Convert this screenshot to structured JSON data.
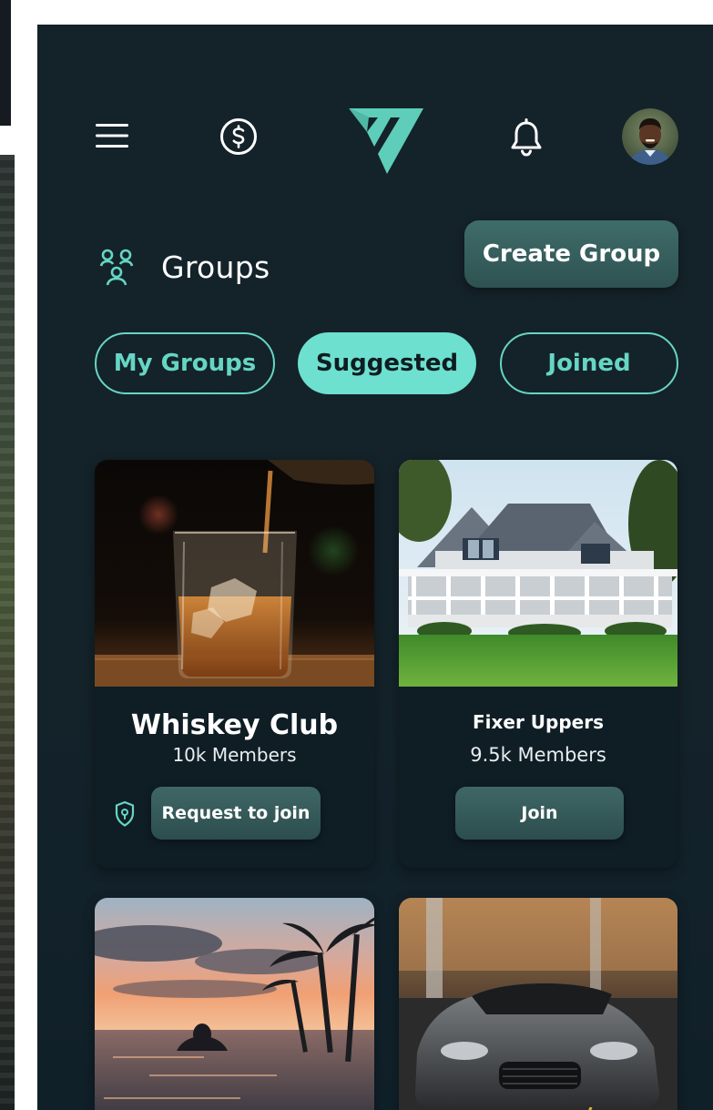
{
  "nav": {
    "menu_icon": "hamburger-menu-icon",
    "wallet_icon": "dollar-coin-icon",
    "logo": "brand-logo",
    "notifications_icon": "bell-icon",
    "avatar": "user-avatar"
  },
  "header": {
    "icon": "groups-icon",
    "title": "Groups",
    "create_button": "Create Group"
  },
  "tabs": [
    {
      "label": "My Groups",
      "active": false
    },
    {
      "label": "Suggested",
      "active": true
    },
    {
      "label": "Joined",
      "active": false
    }
  ],
  "cards": [
    {
      "title": "Whiskey Club",
      "members": "10k Members",
      "action": "Request to join",
      "private": true,
      "image": "whiskey-glass-photo"
    },
    {
      "title": "Fixer Uppers",
      "members": "9.5k Members",
      "action": "Join",
      "private": false,
      "image": "house-photo"
    },
    {
      "image": "beach-sunset-photo"
    },
    {
      "image": "sports-car-photo"
    }
  ],
  "colors": {
    "background": "#14232a",
    "accent": "#6ee0cf",
    "button": "#3a6362",
    "card": "#0f1d25"
  }
}
